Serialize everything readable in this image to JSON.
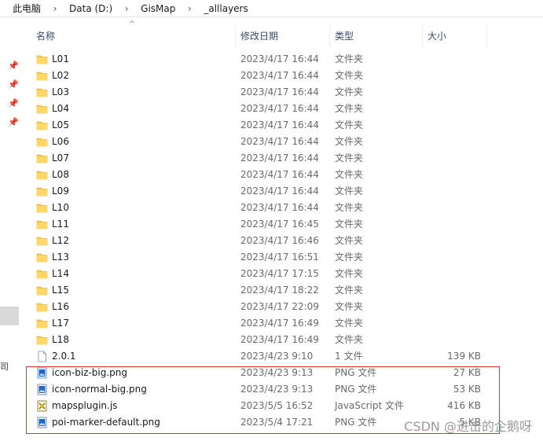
{
  "breadcrumb": [
    "此电脑",
    "Data (D:)",
    "GisMap",
    "_alllayers"
  ],
  "columns": {
    "name": "名称",
    "date": "修改日期",
    "type": "类型",
    "size": "大小"
  },
  "nav_partial_text": "司",
  "files": [
    {
      "name": "L01",
      "date": "2023/4/17 16:44",
      "type": "文件夹",
      "size": "",
      "icon": "folder-icon"
    },
    {
      "name": "L02",
      "date": "2023/4/17 16:44",
      "type": "文件夹",
      "size": "",
      "icon": "folder-icon"
    },
    {
      "name": "L03",
      "date": "2023/4/17 16:44",
      "type": "文件夹",
      "size": "",
      "icon": "folder-icon"
    },
    {
      "name": "L04",
      "date": "2023/4/17 16:44",
      "type": "文件夹",
      "size": "",
      "icon": "folder-icon"
    },
    {
      "name": "L05",
      "date": "2023/4/17 16:44",
      "type": "文件夹",
      "size": "",
      "icon": "folder-icon"
    },
    {
      "name": "L06",
      "date": "2023/4/17 16:44",
      "type": "文件夹",
      "size": "",
      "icon": "folder-icon"
    },
    {
      "name": "L07",
      "date": "2023/4/17 16:44",
      "type": "文件夹",
      "size": "",
      "icon": "folder-icon"
    },
    {
      "name": "L08",
      "date": "2023/4/17 16:44",
      "type": "文件夹",
      "size": "",
      "icon": "folder-icon"
    },
    {
      "name": "L09",
      "date": "2023/4/17 16:44",
      "type": "文件夹",
      "size": "",
      "icon": "folder-icon"
    },
    {
      "name": "L10",
      "date": "2023/4/17 16:44",
      "type": "文件夹",
      "size": "",
      "icon": "folder-icon"
    },
    {
      "name": "L11",
      "date": "2023/4/17 16:45",
      "type": "文件夹",
      "size": "",
      "icon": "folder-icon"
    },
    {
      "name": "L12",
      "date": "2023/4/17 16:46",
      "type": "文件夹",
      "size": "",
      "icon": "folder-icon"
    },
    {
      "name": "L13",
      "date": "2023/4/17 16:51",
      "type": "文件夹",
      "size": "",
      "icon": "folder-icon"
    },
    {
      "name": "L14",
      "date": "2023/4/17 17:15",
      "type": "文件夹",
      "size": "",
      "icon": "folder-icon"
    },
    {
      "name": "L15",
      "date": "2023/4/17 18:22",
      "type": "文件夹",
      "size": "",
      "icon": "folder-icon"
    },
    {
      "name": "L16",
      "date": "2023/4/17 22:09",
      "type": "文件夹",
      "size": "",
      "icon": "folder-icon"
    },
    {
      "name": "L17",
      "date": "2023/4/17 16:49",
      "type": "文件夹",
      "size": "",
      "icon": "folder-icon"
    },
    {
      "name": "L18",
      "date": "2023/4/17 16:49",
      "type": "文件夹",
      "size": "",
      "icon": "folder-icon"
    },
    {
      "name": "2.0.1",
      "date": "2023/4/23 9:10",
      "type": "1 文件",
      "size": "139 KB",
      "icon": "file-icon"
    },
    {
      "name": "icon-biz-big.png",
      "date": "2023/4/23 9:13",
      "type": "PNG 文件",
      "size": "27 KB",
      "icon": "image-file-icon"
    },
    {
      "name": "icon-normal-big.png",
      "date": "2023/4/23 9:13",
      "type": "PNG 文件",
      "size": "53 KB",
      "icon": "image-file-icon"
    },
    {
      "name": "mapsplugin.js",
      "date": "2023/5/5 16:52",
      "type": "JavaScript 文件",
      "size": "416 KB",
      "icon": "js-file-icon"
    },
    {
      "name": "poi-marker-default.png",
      "date": "2023/5/4 17:21",
      "type": "PNG 文件",
      "size": "5 KB",
      "icon": "image-file-icon"
    }
  ],
  "watermark": "CSDN @进击的企鹅呀",
  "colors": {
    "highlight_border": "#d8343a",
    "folder_yellow": "#f5c84c",
    "header_text": "#3a4a6b"
  }
}
